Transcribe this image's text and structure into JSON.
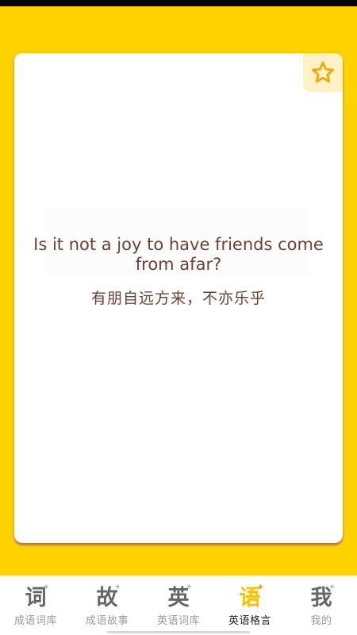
{
  "card": {
    "favorite_icon": "star-outline-icon",
    "quote_en": "Is it not a joy to have friends come from afar?",
    "quote_zh": "有朋自远方来，不亦乐乎"
  },
  "tabs": [
    {
      "icon_glyph": "词",
      "label": "成语词库",
      "active": false
    },
    {
      "icon_glyph": "故",
      "label": "成语故事",
      "active": false
    },
    {
      "icon_glyph": "英",
      "label": "英语词库",
      "active": false
    },
    {
      "icon_glyph": "语",
      "label": "英语格言",
      "active": true
    },
    {
      "icon_glyph": "我",
      "label": "我的",
      "active": false
    }
  ],
  "colors": {
    "background": "#ffd200",
    "accent_text": "#6b4334",
    "active_tab": "#ffc000",
    "inactive_tab": "#9a9a9a"
  }
}
